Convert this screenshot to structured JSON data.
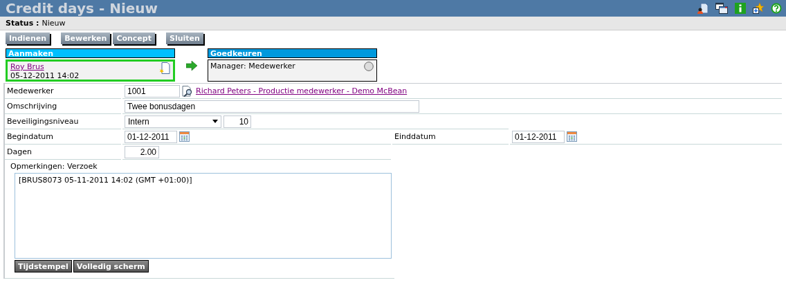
{
  "window": {
    "title": "Credit days - Nieuw"
  },
  "status": {
    "label": "Status :",
    "value": "Nieuw"
  },
  "actions": [
    "Indienen",
    "Bewerken",
    "Concept",
    "Sluiten"
  ],
  "workflow": [
    {
      "title": "Aanmaken",
      "kind": "done",
      "link": "Roy Brus",
      "date": "05-12-2011 14:02"
    },
    {
      "title": "Goedkeuren",
      "kind": "pending",
      "text": "Manager: Medewerker"
    }
  ],
  "form": {
    "employee": {
      "label": "Medewerker",
      "value": "1001",
      "link": "Richard Peters - Productie medewerker - Demo McBean"
    },
    "description": {
      "label": "Omschrijving",
      "value": "Twee bonusdagen"
    },
    "security": {
      "label": "Beveiligingsniveau",
      "value": "Intern",
      "level_value": "10"
    },
    "start": {
      "label": "Begindatum",
      "value": "01-12-2011"
    },
    "end": {
      "label": "Einddatum",
      "value": "01-12-2011"
    },
    "days": {
      "label": "Dagen",
      "value": "2.00"
    },
    "remarks": {
      "label": "Opmerkingen: Verzoek",
      "value": "[BRUS8073 05-11-2011 14:02 (GMT +01:00)]"
    }
  },
  "remark_buttons": [
    "Tijdstempel",
    "Volledig scherm"
  ]
}
